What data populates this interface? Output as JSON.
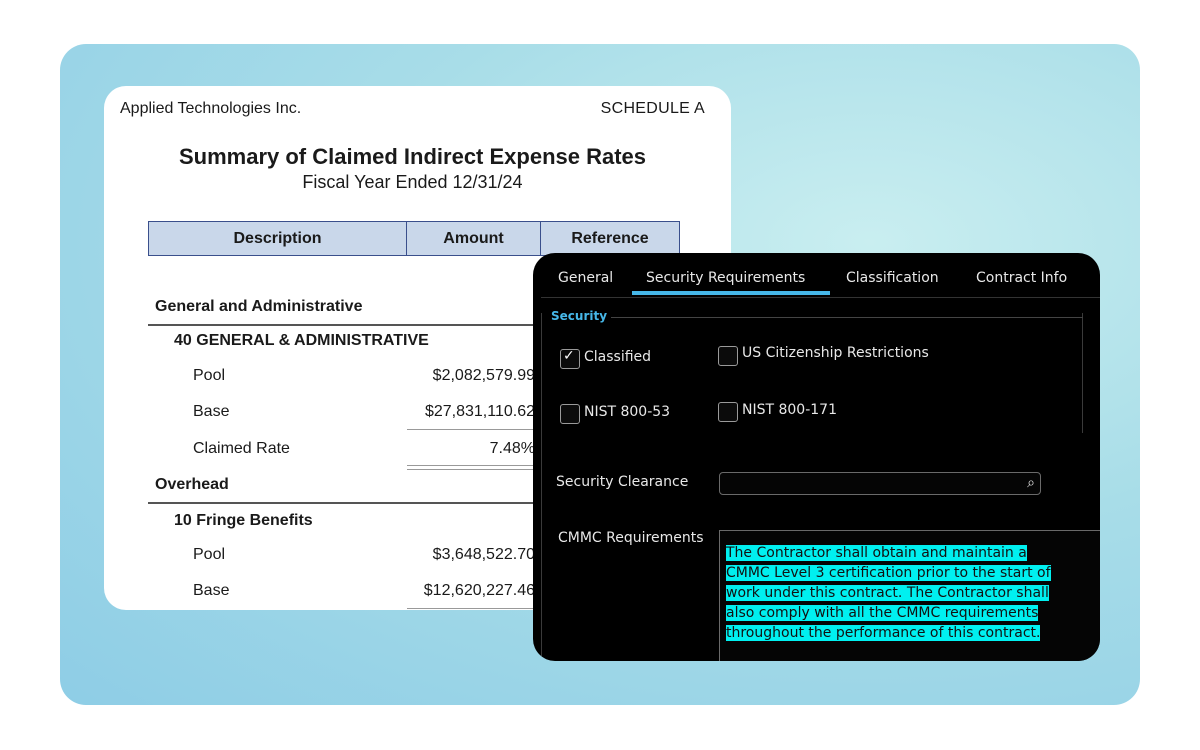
{
  "document": {
    "company": "Applied Technologies Inc.",
    "schedule": "SCHEDULE A",
    "title": "Summary of Claimed Indirect Expense Rates",
    "subtitle": "Fiscal Year Ended 12/31/24",
    "columns": [
      "Description",
      "Amount",
      "Reference"
    ],
    "sections": {
      "ga_heading": "General and Administrative",
      "ga_sub": "40 GENERAL & ADMINISTRATIVE",
      "ga_pool_label": "Pool",
      "ga_pool_value": "$2,082,579.99",
      "ga_base_label": "Base",
      "ga_base_value": "$27,831,110.62",
      "ga_rate_label": "Claimed Rate",
      "ga_rate_value": "7.48%",
      "oh_heading": "Overhead",
      "oh_sub": "10 Fringe Benefits",
      "oh_pool_label": "Pool",
      "oh_pool_value": "$3,648,522.70",
      "oh_base_label": "Base",
      "oh_base_value": "$12,620,227.46"
    }
  },
  "dialog": {
    "tabs": [
      "General",
      "Security Requirements",
      "Classification",
      "Contract Info"
    ],
    "active_tab": "Security Requirements",
    "section_title": "Security",
    "checkboxes": {
      "classified": {
        "label": "Classified",
        "checked": true
      },
      "us_citizenship": {
        "label": "US Citizenship Restrictions",
        "checked": false
      },
      "nist_800_53": {
        "label": "NIST 800-53",
        "checked": false
      },
      "nist_800_171": {
        "label": "NIST 800-171",
        "checked": false
      }
    },
    "security_clearance_label": "Security Clearance",
    "security_clearance_value": "",
    "cmmc_label": "CMMC Requirements",
    "cmmc_text_lines": [
      "The Contractor shall obtain and maintain a",
      "CMMC Level 3 certification prior to the start of",
      "work under this contract.  The Contractor shall",
      "also comply with all the CMMC requirements",
      "throughout the performance of this contract."
    ],
    "accent_color": "#46b7e8",
    "highlight_color": "#00f0f0"
  }
}
